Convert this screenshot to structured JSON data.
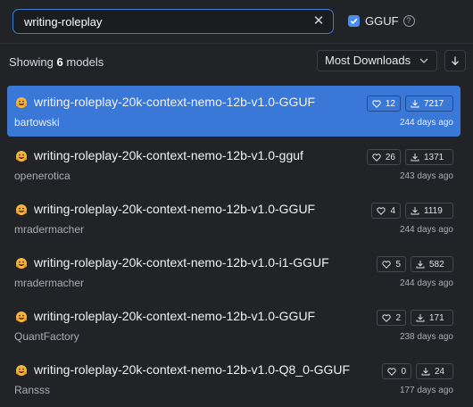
{
  "search": {
    "value": "writing-roleplay"
  },
  "filter": {
    "label": "GGUF",
    "checked": true
  },
  "results": {
    "prefix": "Showing",
    "count": "6",
    "suffix": "models"
  },
  "sort": {
    "selected": "Most Downloads"
  },
  "colors": {
    "accent": "#3a78d8",
    "background": "#212327"
  },
  "models": [
    {
      "name": "writing-roleplay-20k-context-nemo-12b-v1.0-GGUF",
      "author": "bartowski",
      "likes": "12",
      "downloads": "7217",
      "updated": "244 days ago",
      "selected": true
    },
    {
      "name": "writing-roleplay-20k-context-nemo-12b-v1.0-gguf",
      "author": "openerotica",
      "likes": "26",
      "downloads": "1371",
      "updated": "243 days ago",
      "selected": false
    },
    {
      "name": "writing-roleplay-20k-context-nemo-12b-v1.0-GGUF",
      "author": "mradermacher",
      "likes": "4",
      "downloads": "1119",
      "updated": "244 days ago",
      "selected": false
    },
    {
      "name": "writing-roleplay-20k-context-nemo-12b-v1.0-i1-GGUF",
      "author": "mradermacher",
      "likes": "5",
      "downloads": "582",
      "updated": "244 days ago",
      "selected": false
    },
    {
      "name": "writing-roleplay-20k-context-nemo-12b-v1.0-GGUF",
      "author": "QuantFactory",
      "likes": "2",
      "downloads": "171",
      "updated": "238 days ago",
      "selected": false
    },
    {
      "name": "writing-roleplay-20k-context-nemo-12b-v1.0-Q8_0-GGUF",
      "author": "Ransss",
      "likes": "0",
      "downloads": "24",
      "updated": "177 days ago",
      "selected": false
    }
  ]
}
